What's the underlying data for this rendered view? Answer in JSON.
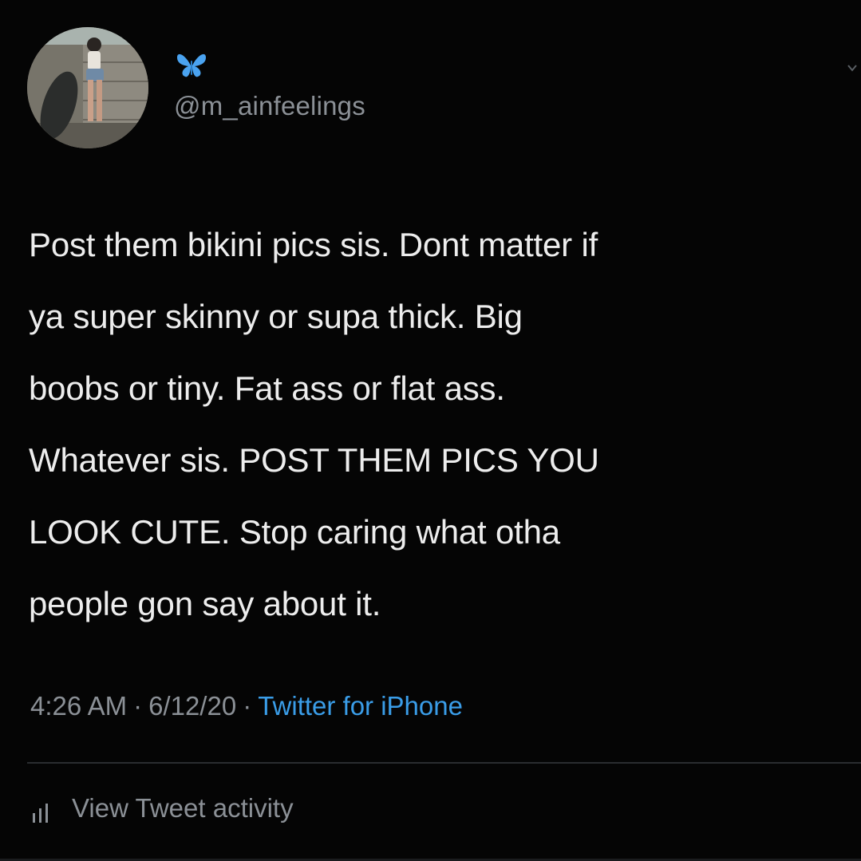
{
  "author": {
    "avatar_icon": "profile-photo",
    "display_name_icon": "blue-butterfly-icon",
    "handle": "@m_ainfeelings",
    "menu_icon": "chevron-down-icon"
  },
  "tweet": {
    "text": "Post them bikini pics sis. Dont matter if\nya super skinny or supa thick. Big\nboobs or tiny. Fat ass or flat ass.\nWhatever sis. POST THEM PICS YOU\nLOOK CUTE. Stop caring what otha\npeople gon say about it.",
    "time": "4:26 AM",
    "date": "6/12/20",
    "separator": "·",
    "source": "Twitter for iPhone"
  },
  "activity": {
    "icon": "analytics-bars-icon",
    "label": "View Tweet activity"
  },
  "colors": {
    "background": "#050505",
    "text": "#ededed",
    "muted": "#8b9096",
    "link": "#3a9de8",
    "butterfly": "#4aa3f0"
  }
}
